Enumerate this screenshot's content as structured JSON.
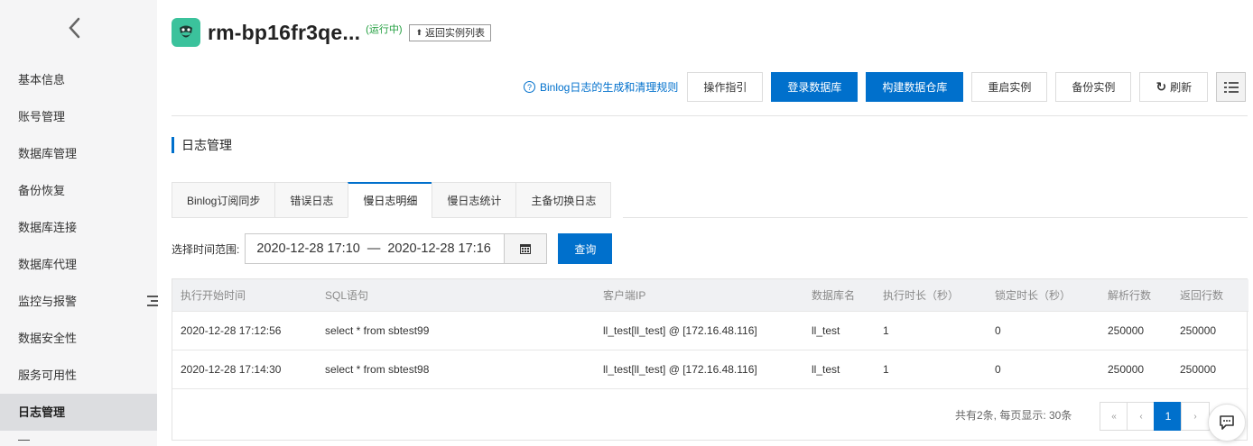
{
  "sidebar": {
    "items": [
      {
        "label": "基本信息",
        "active": false
      },
      {
        "label": "账号管理",
        "active": false
      },
      {
        "label": "数据库管理",
        "active": false
      },
      {
        "label": "备份恢复",
        "active": false
      },
      {
        "label": "数据库连接",
        "active": false
      },
      {
        "label": "数据库代理",
        "active": false
      },
      {
        "label": "监控与报警",
        "active": false
      },
      {
        "label": "数据安全性",
        "active": false
      },
      {
        "label": "服务可用性",
        "active": false
      },
      {
        "label": "日志管理",
        "active": true
      },
      {
        "label": "—",
        "active": false
      }
    ]
  },
  "header": {
    "instance_name": "rm-bp16fr3qe...",
    "status": "(运行中)",
    "back_to_list": "返回实例列表"
  },
  "toolbar": {
    "help_link": "Binlog日志的生成和清理规则",
    "buttons": [
      "操作指引",
      "登录数据库",
      "构建数据仓库",
      "重启实例",
      "备份实例",
      "刷新"
    ]
  },
  "section_title": "日志管理",
  "tabs": [
    {
      "label": "Binlog订阅同步",
      "active": false
    },
    {
      "label": "错误日志",
      "active": false
    },
    {
      "label": "慢日志明细",
      "active": true
    },
    {
      "label": "慢日志统计",
      "active": false
    },
    {
      "label": "主备切换日志",
      "active": false
    }
  ],
  "filter": {
    "label": "选择时间范围:",
    "start": "2020-12-28 17:10",
    "separator": "—",
    "end": "2020-12-28 17:16",
    "query_button": "查询"
  },
  "table": {
    "columns": [
      "执行开始时间",
      "SQL语句",
      "客户端IP",
      "数据库名",
      "执行时长（秒）",
      "锁定时长（秒）",
      "解析行数",
      "返回行数"
    ],
    "rows": [
      [
        "2020-12-28 17:12:56",
        "select * from sbtest99",
        "ll_test[ll_test] @ [172.16.48.116]",
        "ll_test",
        "1",
        "0",
        "250000",
        "250000"
      ],
      [
        "2020-12-28 17:14:30",
        "select * from sbtest98",
        "ll_test[ll_test] @ [172.16.48.116]",
        "ll_test",
        "1",
        "0",
        "250000",
        "250000"
      ]
    ]
  },
  "pagination": {
    "summary": "共有2条, 每页显示: 30条",
    "first": "«",
    "prev": "‹",
    "current_page": "1",
    "next": "›"
  },
  "colors": {
    "primary": "#0070cc",
    "status_running": "#1e9d3c",
    "logo": "#3bc29c",
    "sidebar_bg": "#f5f5f6"
  },
  "icons": {
    "back": "chevron-left-icon",
    "logo": "database-logo-icon",
    "help": "question-circle-icon",
    "refresh": "refresh-icon",
    "list_view": "list-view-icon",
    "calendar": "calendar-icon",
    "chat": "chat-icon"
  }
}
